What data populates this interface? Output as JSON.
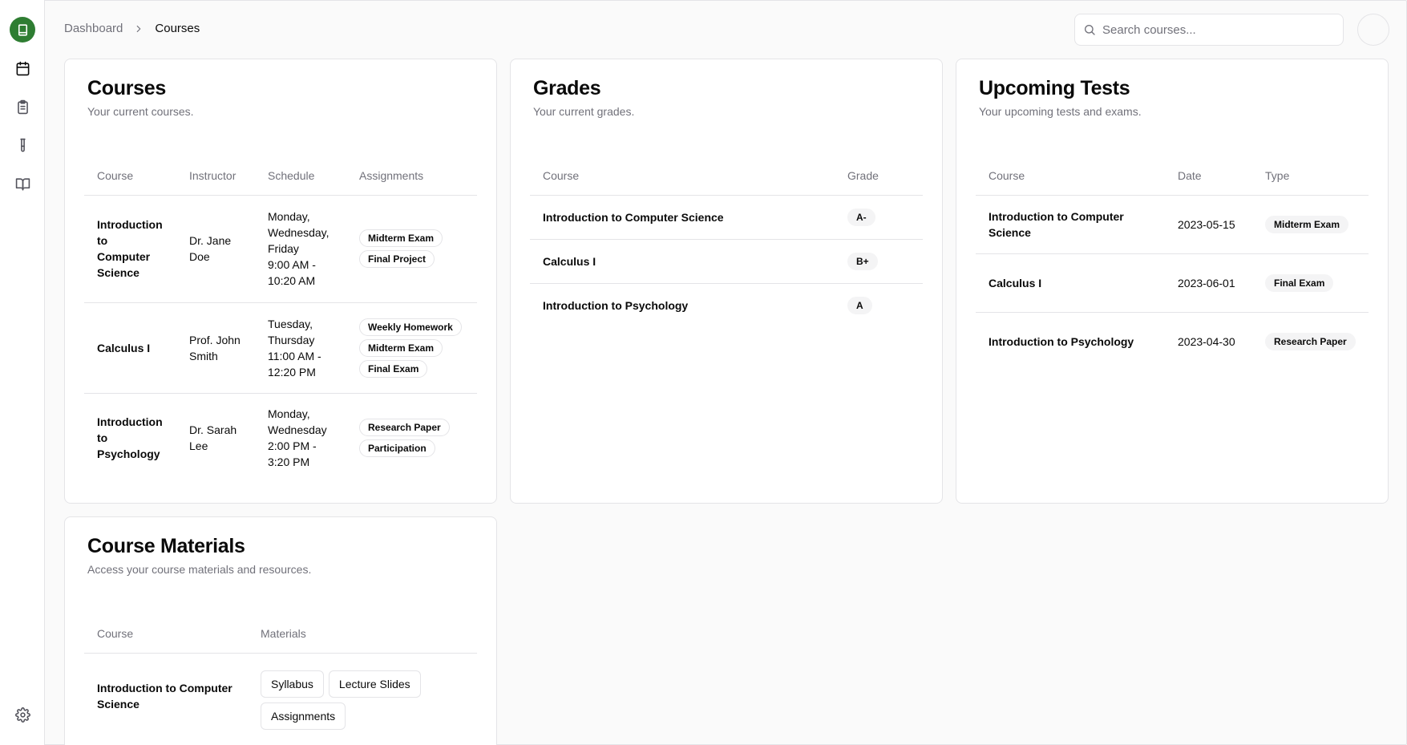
{
  "breadcrumb": {
    "root": "Dashboard",
    "current": "Courses"
  },
  "search": {
    "placeholder": "Search courses...",
    "value": ""
  },
  "courses_card": {
    "title": "Courses",
    "description": "Your current courses.",
    "headers": [
      "Course",
      "Instructor",
      "Schedule",
      "Assignments"
    ],
    "rows": [
      {
        "course": "Introduction to Computer Science",
        "instructor": "Dr. Jane Doe",
        "schedule_days": "Monday, Wednesday, Friday",
        "schedule_time": "9:00 AM - 10:20 AM",
        "assignments": [
          "Midterm Exam",
          "Final Project"
        ]
      },
      {
        "course": "Calculus I",
        "instructor": "Prof. John Smith",
        "schedule_days": "Tuesday, Thursday",
        "schedule_time": "11:00 AM - 12:20 PM",
        "assignments": [
          "Weekly Homework",
          "Midterm Exam",
          "Final Exam"
        ]
      },
      {
        "course": "Introduction to Psychology",
        "instructor": "Dr. Sarah Lee",
        "schedule_days": "Monday, Wednesday",
        "schedule_time": "2:00 PM - 3:20 PM",
        "assignments": [
          "Research Paper",
          "Participation"
        ]
      }
    ]
  },
  "grades_card": {
    "title": "Grades",
    "description": "Your current grades.",
    "headers": [
      "Course",
      "Grade"
    ],
    "rows": [
      {
        "course": "Introduction to Computer Science",
        "grade": "A-"
      },
      {
        "course": "Calculus I",
        "grade": "B+"
      },
      {
        "course": "Introduction to Psychology",
        "grade": "A"
      }
    ]
  },
  "tests_card": {
    "title": "Upcoming Tests",
    "description": "Your upcoming tests and exams.",
    "headers": [
      "Course",
      "Date",
      "Type"
    ],
    "rows": [
      {
        "course": "Introduction to Computer Science",
        "date": "2023-05-15",
        "type": "Midterm Exam"
      },
      {
        "course": "Calculus I",
        "date": "2023-06-01",
        "type": "Final Exam"
      },
      {
        "course": "Introduction to Psychology",
        "date": "2023-04-30",
        "type": "Research Paper"
      }
    ]
  },
  "materials_card": {
    "title": "Course Materials",
    "description": "Access your course materials and resources.",
    "headers": [
      "Course",
      "Materials"
    ],
    "rows": [
      {
        "course": "Introduction to Computer Science",
        "materials": [
          "Syllabus",
          "Lecture Slides",
          "Assignments"
        ]
      }
    ]
  },
  "sidebar": {
    "items": [
      {
        "icon": "book-logo-icon"
      },
      {
        "icon": "calendar-icon"
      },
      {
        "icon": "clipboard-icon"
      },
      {
        "icon": "test-tube-icon"
      },
      {
        "icon": "open-book-icon"
      },
      {
        "icon": "settings-icon"
      }
    ]
  },
  "colors": {
    "accent": "#2e7d32",
    "border": "#e4e4e7",
    "muted": "#71717a"
  }
}
